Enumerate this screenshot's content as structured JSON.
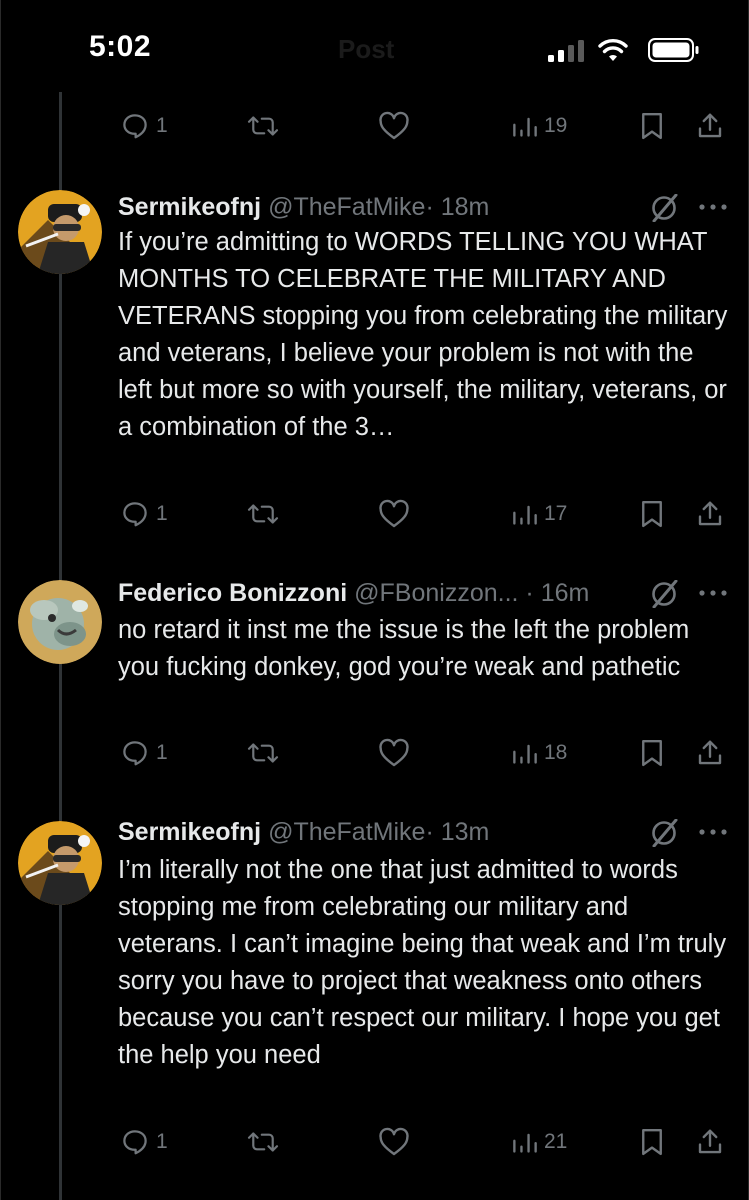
{
  "status_bar": {
    "time": "5:02",
    "ghost_title": "Post"
  },
  "top_actions": {
    "replies": "1",
    "views": "19"
  },
  "tweets": [
    {
      "name": "Sermikeofnj",
      "handle": "@TheFatMike",
      "time": "· 18m",
      "text": "If you’re admitting to WORDS TELLING YOU WHAT MONTHS TO CELEBRATE THE MILITARY AND VETERANS stopping you from celebrating the military and veterans, I believe your problem is not with the left but more so with yourself, the military, veterans, or a combination of the 3…",
      "replies": "1",
      "views": "17"
    },
    {
      "name": "Federico Bonizzoni",
      "handle": "@FBonizzon...",
      "time": " · 16m",
      "text": "no retard it inst me the issue is the left the problem you fucking donkey, god you’re weak and pathetic",
      "replies": "1",
      "views": "18"
    },
    {
      "name": "Sermikeofnj",
      "handle": "@TheFatMike",
      "time": "· 13m",
      "text": "I’m literally not the one that just admitted to words stopping me from celebrating our military and veterans. I can’t imagine being that weak and I’m truly sorry you have to project that weakness onto others because you can’t respect our military. I hope you get the help you need",
      "replies": "1",
      "views": "21"
    }
  ],
  "icons": {
    "reply": "reply-icon",
    "repost": "repost-icon",
    "like": "heart-icon",
    "views": "views-icon",
    "bookmark": "bookmark-icon",
    "share": "share-icon",
    "grok": "grok-icon",
    "more": "more-icon"
  },
  "colors": {
    "background": "#000000",
    "text": "#e7e9ea",
    "muted": "#71767b"
  }
}
